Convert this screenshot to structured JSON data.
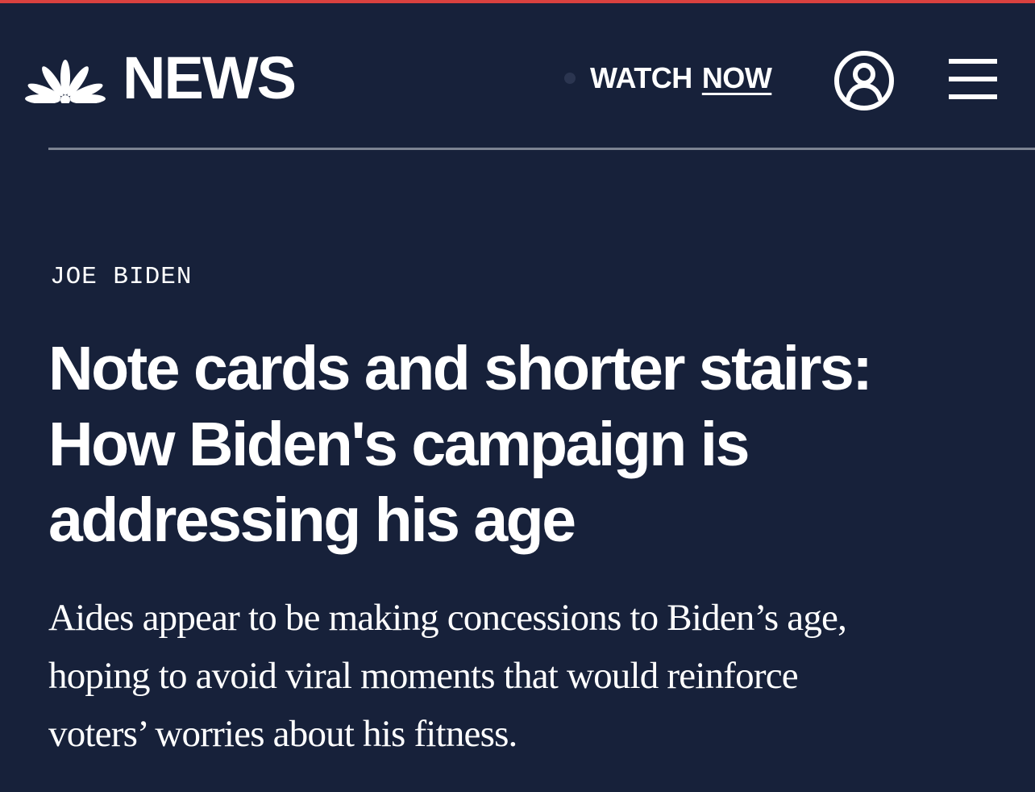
{
  "colors": {
    "background": "#17213a",
    "accent_bar": "#d9413f",
    "divider": "#7c8392",
    "text": "#ffffff"
  },
  "header": {
    "logo_icon": "nbc-peacock-icon",
    "logo_text": "NEWS",
    "watch_label": "WATCH",
    "watch_now_label": "NOW",
    "account_icon": "user-circle-icon",
    "menu_icon": "hamburger-menu-icon"
  },
  "article": {
    "section": "JOE BIDEN",
    "headline_lines": [
      "Note cards and shorter stairs:",
      "How Biden's campaign is",
      "addressing his age"
    ],
    "dek_lines": [
      "Aides appear to be making concessions to Biden’s age,",
      "hoping to avoid viral moments that would reinforce",
      "voters’ worries about his fitness."
    ]
  }
}
